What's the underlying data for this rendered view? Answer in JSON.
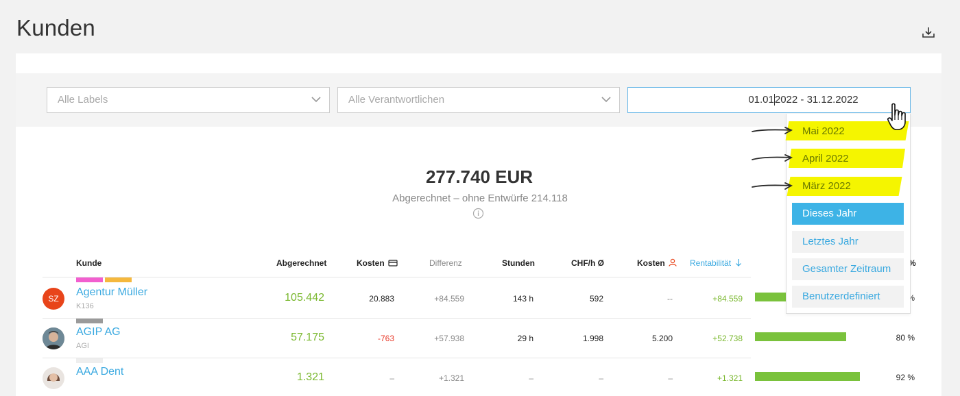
{
  "page": {
    "title": "Kunden"
  },
  "filters": {
    "labels_placeholder": "Alle Labels",
    "owner_placeholder": "Alle Verantwortlichen",
    "date_range_part1": "01.01",
    "date_range_part2": "2022 - 31.12.2022"
  },
  "summary": {
    "total": "277.740 EUR",
    "subtitle": "Abgerechnet – ohne Entwürfe 214.118"
  },
  "table": {
    "headers": {
      "kunde": "Kunde",
      "abgerechnet": "Abgerechnet",
      "kosten": "Kosten",
      "differenz": "Differenz",
      "stunden": "Stunden",
      "chf_h": "CHF/h Ø",
      "kosten_person": "Kosten",
      "rentabilitaet": "Rentabilität",
      "prozent": "%"
    },
    "rows": [
      {
        "avatar_initials": "SZ",
        "name": "Agentur Müller",
        "code": "K136",
        "labels": [
          "#f25fcf",
          "#f5b83d"
        ],
        "abgerechnet": "105.442",
        "kosten": "20.883",
        "differenz": "+84.559",
        "stunden": "143 h",
        "chf_h": "592",
        "kosten_person": "--",
        "rentabilitaet": "+84.559",
        "bar_fraction": 0.8,
        "prozent": "%"
      },
      {
        "avatar_initials": "",
        "name": "AGIP AG",
        "code": "AGI",
        "labels": [
          "#9a9a9a"
        ],
        "abgerechnet": "57.175",
        "kosten": "-763",
        "differenz": "+57.938",
        "stunden": "29 h",
        "chf_h": "1.998",
        "kosten_person": "5.200",
        "rentabilitaet": "+52.738",
        "bar_fraction": 0.8,
        "prozent": "80 %"
      },
      {
        "avatar_initials": "",
        "name": "AAA Dent",
        "code": "",
        "labels": [
          "#eeeeee"
        ],
        "abgerechnet": "1.321",
        "kosten": "–",
        "differenz": "+1.321",
        "stunden": "–",
        "chf_h": "–",
        "kosten_person": "–",
        "rentabilitaet": "+1.321",
        "bar_fraction": 0.92,
        "prozent": "92 %"
      }
    ]
  },
  "date_dropdown": {
    "items": [
      {
        "label": "Mai 2022",
        "highlighted": true
      },
      {
        "label": "April 2022",
        "highlighted": true
      },
      {
        "label": "März 2022",
        "highlighted": true
      },
      {
        "label": "Dieses Jahr",
        "active": true
      },
      {
        "label": "Letztes Jahr"
      },
      {
        "label": "Gesamter Zeitraum"
      },
      {
        "label": "Benutzerdefiniert"
      }
    ]
  },
  "colors": {
    "accent": "#3aa9e0",
    "positive": "#7ab82f",
    "negative": "#e83a2a",
    "highlight": "#f5f500",
    "avatar_sz": "#e8441a"
  },
  "icons": [
    "download-icon",
    "chevron-down-icon",
    "info-icon",
    "card-icon",
    "person-icon",
    "sort-down-icon",
    "pointer-hand-icon",
    "arrow-annotation-icon"
  ]
}
